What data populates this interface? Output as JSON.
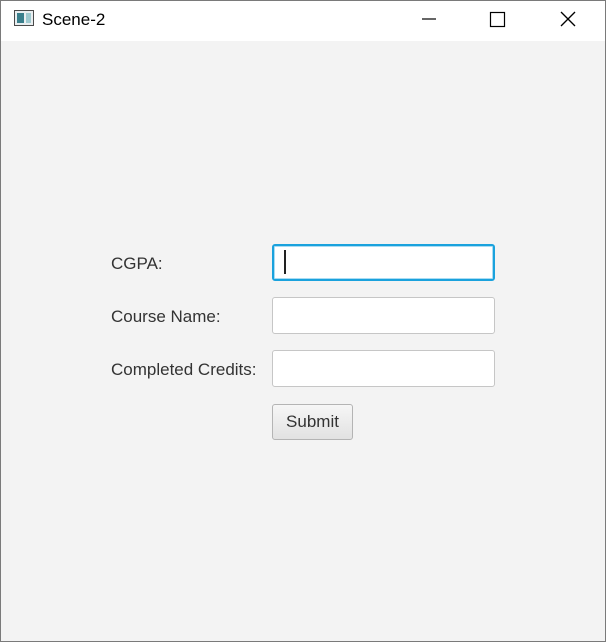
{
  "window": {
    "title": "Scene-2",
    "controls": {
      "minimize": "minimize-icon",
      "maximize": "maximize-icon",
      "close": "close-icon"
    }
  },
  "form": {
    "cgpa_label": "CGPA:",
    "cgpa_value": "",
    "course_label": "Course Name:",
    "course_value": "",
    "credits_label": "Completed Credits:",
    "credits_value": "",
    "submit_label": "Submit"
  },
  "colors": {
    "focus_border": "#1aa2dd",
    "window_background": "#f3f3f3",
    "titlebar_background": "#ffffff"
  }
}
